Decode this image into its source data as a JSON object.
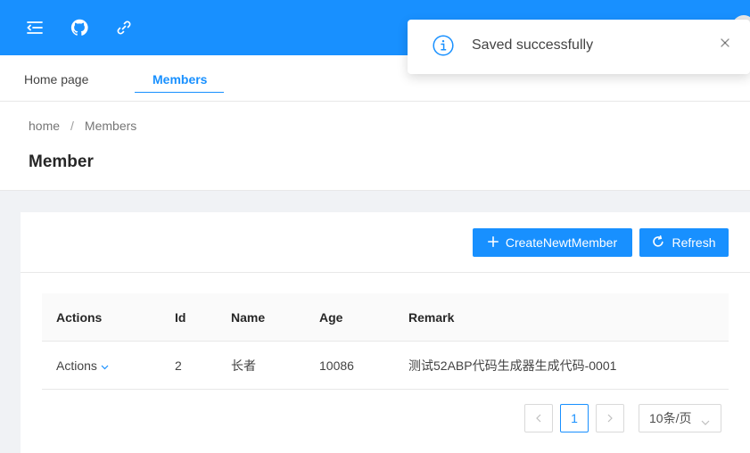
{
  "header": {
    "icons": [
      "menu-fold-icon",
      "github-icon",
      "link-icon"
    ],
    "accent_color": "#1890ff"
  },
  "tabs": [
    {
      "label": "Home page",
      "active": false
    },
    {
      "label": "Members",
      "active": true
    }
  ],
  "breadcrumb": {
    "items": [
      "home",
      "Members"
    ],
    "separator": "/"
  },
  "page_title": "Member",
  "toolbar": {
    "create_label": "CreateNewtMember",
    "refresh_label": "Refresh"
  },
  "table": {
    "columns": [
      "Actions",
      "Id",
      "Name",
      "Age",
      "Remark"
    ],
    "rows": [
      {
        "actions": "Actions",
        "id": "2",
        "name": "长者",
        "age": "10086",
        "remark": "测试52ABP代码生成器生成代码-0001"
      }
    ]
  },
  "pagination": {
    "current_page": "1",
    "page_size": "10条/页"
  },
  "notification": {
    "message": "Saved successfully",
    "icon": "info-circle-icon"
  }
}
